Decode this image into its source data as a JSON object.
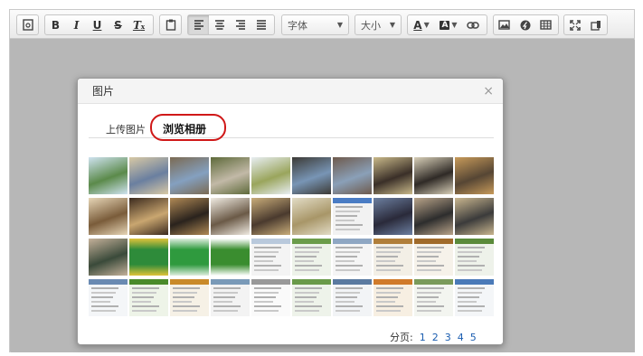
{
  "toolbar": {
    "font_select": "字体",
    "size_select": "大小"
  },
  "dialog": {
    "title": "图片",
    "close": "×",
    "tabs": [
      {
        "label": "上传图片",
        "active": false
      },
      {
        "label": "浏览相册",
        "active": true
      }
    ],
    "pager_label": "分页:",
    "pages": [
      "1",
      "2",
      "3",
      "4",
      "5"
    ]
  },
  "colors": {
    "accent_highlight": "#d01818",
    "link": "#1a5db0",
    "editor_bg": "#b7b7b7"
  },
  "thumbnails": [
    {
      "kind": "photo",
      "c1": "#5b8a4a",
      "c2": "#cfe3f0"
    },
    {
      "kind": "photo",
      "c1": "#6a7fa0",
      "c2": "#d8c9a5"
    },
    {
      "kind": "photo",
      "c1": "#84a0c0",
      "c2": "#7b6a52"
    },
    {
      "kind": "photo",
      "c1": "#c2b9a7",
      "c2": "#5e6a3a"
    },
    {
      "kind": "photo",
      "c1": "#9aa55c",
      "c2": "#e8eef2"
    },
    {
      "kind": "photo",
      "c1": "#7895b5",
      "c2": "#3c3a35"
    },
    {
      "kind": "photo",
      "c1": "#8aa0b8",
      "c2": "#6e5a4c"
    },
    {
      "kind": "photo",
      "c1": "#3a2f28",
      "c2": "#c9b98a"
    },
    {
      "kind": "photo",
      "c1": "#2f2a26",
      "c2": "#d8cfb8"
    },
    {
      "kind": "photo",
      "c1": "#564634",
      "c2": "#c79a5a"
    },
    {
      "kind": "photo",
      "c1": "#7a5c3a",
      "c2": "#e7d6b7"
    },
    {
      "kind": "photo",
      "c1": "#c9a670",
      "c2": "#3b2a1e"
    },
    {
      "kind": "photo",
      "c1": "#2a231d",
      "c2": "#b08955"
    },
    {
      "kind": "photo",
      "c1": "#6b5a47",
      "c2": "#f0ebe2"
    },
    {
      "kind": "photo",
      "c1": "#4a3a2e",
      "c2": "#c9ad7a"
    },
    {
      "kind": "photo",
      "c1": "#a89668",
      "c2": "#e2dcc6"
    },
    {
      "kind": "doc",
      "c1": "#f2f2f2",
      "c2": "#4a7cc4"
    },
    {
      "kind": "photo",
      "c1": "#2a2a3a",
      "c2": "#6c7fa0"
    },
    {
      "kind": "photo",
      "c1": "#2d2d2d",
      "c2": "#b9a48a"
    },
    {
      "kind": "photo",
      "c1": "#3b3b3b",
      "c2": "#c9b68f"
    },
    {
      "kind": "photo",
      "c1": "#3a4a3a",
      "c2": "#c4b19a"
    },
    {
      "kind": "banner",
      "c1": "#2e8b3a",
      "c2": "#e0c33a"
    },
    {
      "kind": "banner",
      "c1": "#2f9a3e",
      "c2": "#dfeee0"
    },
    {
      "kind": "banner",
      "c1": "#3a8d2f",
      "c2": "#ffffff"
    },
    {
      "kind": "doc",
      "c1": "#f4f4f4",
      "c2": "#b9c9dc"
    },
    {
      "kind": "doc",
      "c1": "#eef3ea",
      "c2": "#6b9c4a"
    },
    {
      "kind": "doc",
      "c1": "#f5f5f5",
      "c2": "#8fa7c3"
    },
    {
      "kind": "doc",
      "c1": "#f3efe6",
      "c2": "#b07e3a"
    },
    {
      "kind": "doc",
      "c1": "#f6f2ea",
      "c2": "#a06a2a"
    },
    {
      "kind": "doc",
      "c1": "#eef2ea",
      "c2": "#5a8a3a"
    },
    {
      "kind": "doc",
      "c1": "#f4f6f8",
      "c2": "#6a8ab2"
    },
    {
      "kind": "doc",
      "c1": "#eef4e8",
      "c2": "#4a8a2a"
    },
    {
      "kind": "doc",
      "c1": "#f6f1e6",
      "c2": "#c98a2a"
    },
    {
      "kind": "doc",
      "c1": "#f3f3f3",
      "c2": "#7a9ab8"
    },
    {
      "kind": "doc",
      "c1": "#fafafa",
      "c2": "#999999"
    },
    {
      "kind": "doc",
      "c1": "#eef3ea",
      "c2": "#6a9a4a"
    },
    {
      "kind": "doc",
      "c1": "#f2f4f6",
      "c2": "#5a7aa0"
    },
    {
      "kind": "doc",
      "c1": "#f7efe2",
      "c2": "#d07a2a"
    },
    {
      "kind": "doc",
      "c1": "#f3f5f0",
      "c2": "#7a9a5a"
    },
    {
      "kind": "doc",
      "c1": "#f4f6f8",
      "c2": "#4a7ab8"
    }
  ]
}
